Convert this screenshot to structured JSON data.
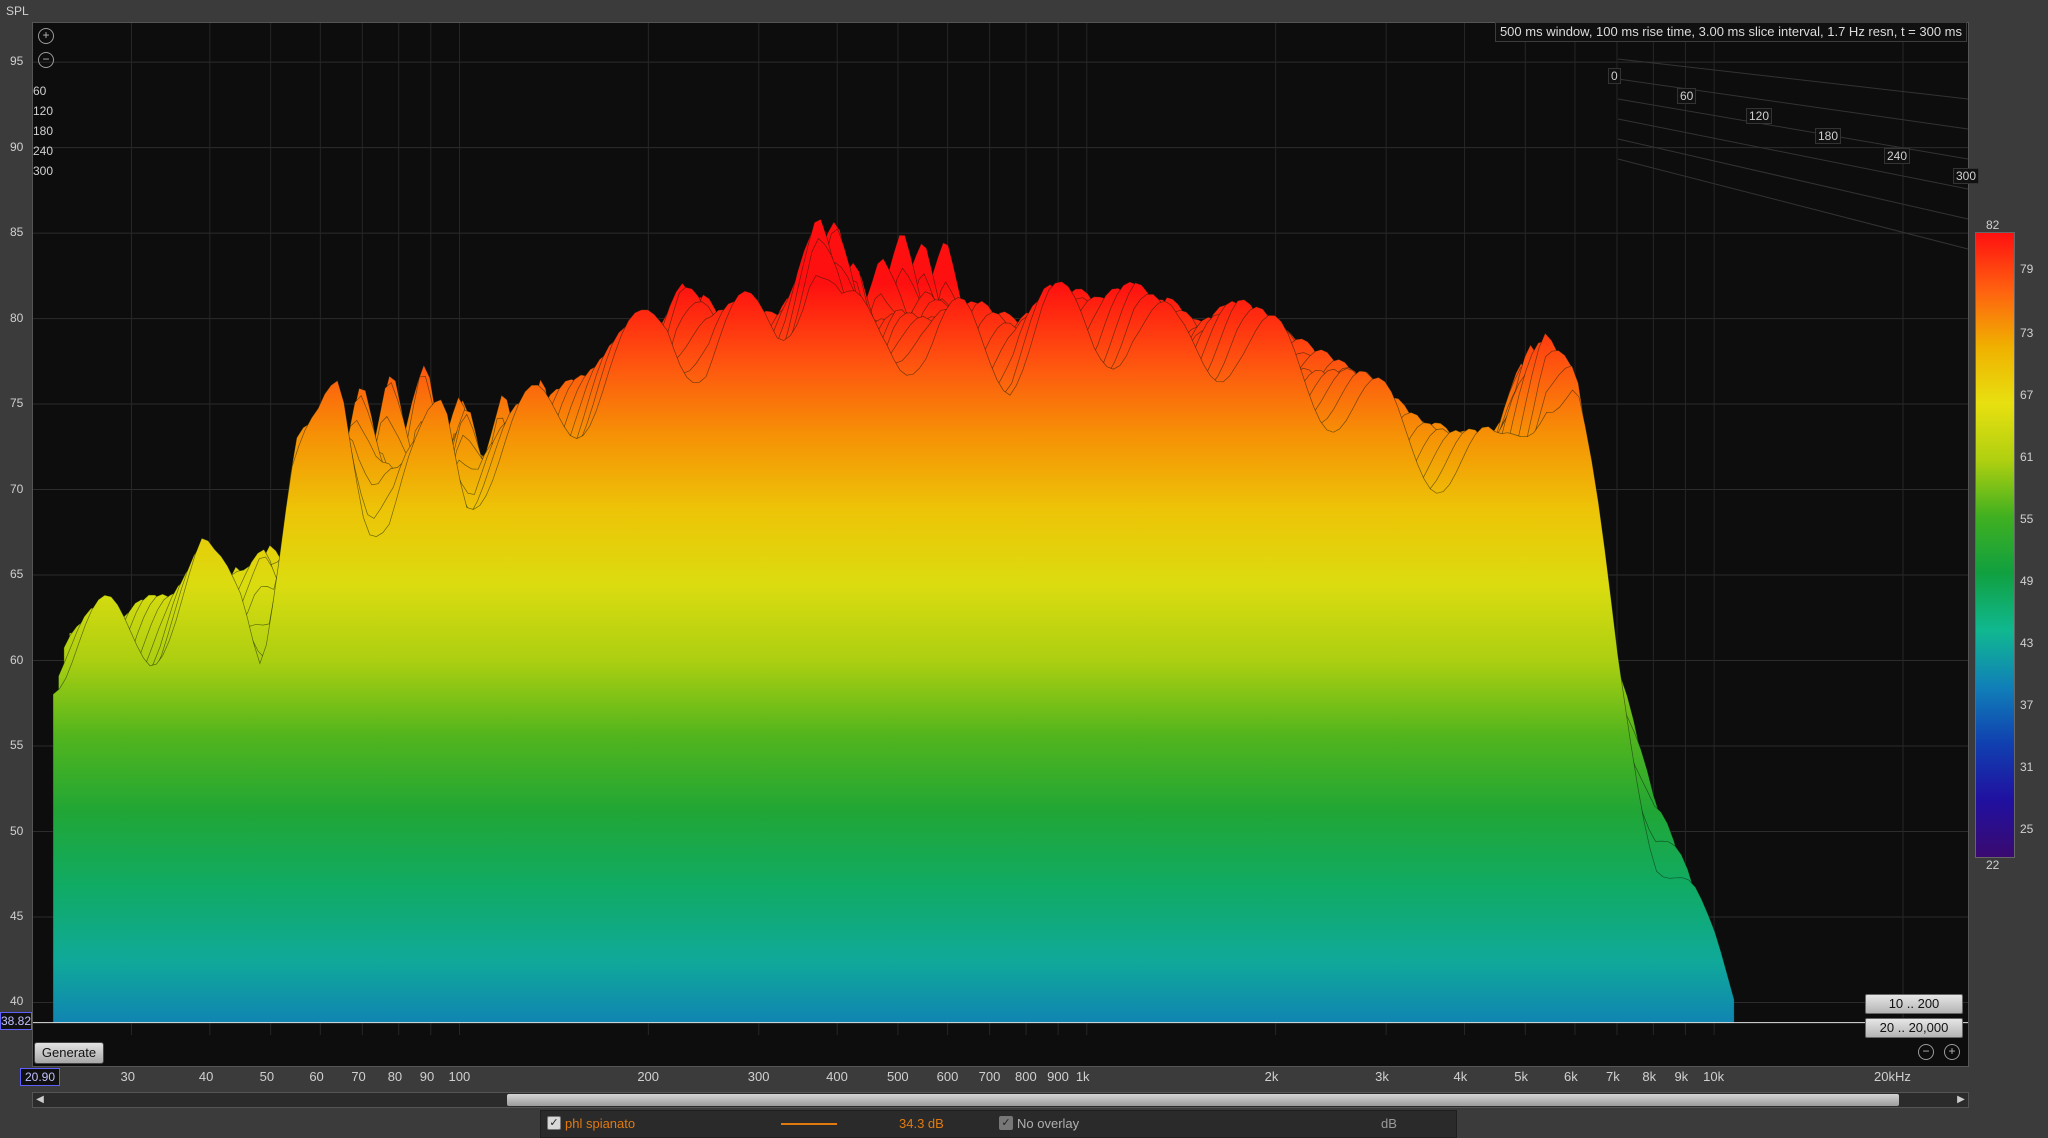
{
  "header": {
    "axis_title": "SPL",
    "info": "500 ms window, 100 ms rise time, 3.00 ms slice interval, 1.7 Hz resn, t = 300 ms"
  },
  "chart_data": {
    "type": "waterfall",
    "title": "",
    "y_label": "SPL",
    "y_ticks": [
      "95",
      "90",
      "85",
      "80",
      "75",
      "70",
      "65",
      "60",
      "55",
      "50",
      "45",
      "40"
    ],
    "ylim": [
      38.8,
      96
    ],
    "x_scale": "log",
    "xlim": [
      20.9,
      20000
    ],
    "x_ticks": [
      {
        "v": 30,
        "t": "30"
      },
      {
        "v": 40,
        "t": "40"
      },
      {
        "v": 50,
        "t": "50"
      },
      {
        "v": 60,
        "t": "60"
      },
      {
        "v": 70,
        "t": "70"
      },
      {
        "v": 80,
        "t": "80"
      },
      {
        "v": 90,
        "t": "90"
      },
      {
        "v": 100,
        "t": "100"
      },
      {
        "v": 200,
        "t": "200"
      },
      {
        "v": 300,
        "t": "300"
      },
      {
        "v": 400,
        "t": "400"
      },
      {
        "v": 500,
        "t": "500"
      },
      {
        "v": 600,
        "t": "600"
      },
      {
        "v": 700,
        "t": "700"
      },
      {
        "v": 800,
        "t": "800"
      },
      {
        "v": 900,
        "t": "900"
      },
      {
        "v": 1000,
        "t": "1k"
      },
      {
        "v": 2000,
        "t": "2k"
      },
      {
        "v": 3000,
        "t": "3k"
      },
      {
        "v": 4000,
        "t": "4k"
      },
      {
        "v": 5000,
        "t": "5k"
      },
      {
        "v": 6000,
        "t": "6k"
      },
      {
        "v": 7000,
        "t": "7k"
      },
      {
        "v": 8000,
        "t": "8k"
      },
      {
        "v": 9000,
        "t": "9k"
      },
      {
        "v": 10000,
        "t": "10k"
      },
      {
        "v": 20000,
        "t": "20kHz"
      }
    ],
    "time_ticks": [
      "0",
      "60",
      "120",
      "180",
      "240",
      "300"
    ],
    "time_unit": "ms",
    "colormap": {
      "min": 22,
      "max": 82,
      "labels": [
        "82",
        "79",
        "73",
        "67",
        "61",
        "55",
        "49",
        "43",
        "37",
        "31",
        "25",
        "22"
      ],
      "stops": [
        "#ff1010",
        "#ff6010",
        "#f0b000",
        "#e8e010",
        "#b0d010",
        "#40b020",
        "#10a040",
        "#10b890",
        "#1080b8",
        "#1040b0",
        "#2010a0",
        "#3a0a70"
      ]
    },
    "front_slice_peaks": [
      {
        "f": 22,
        "db": 60.5
      },
      {
        "f": 26,
        "db": 61.5
      },
      {
        "f": 30,
        "db": 62
      },
      {
        "f": 33,
        "db": 63.5
      },
      {
        "f": 36,
        "db": 65
      },
      {
        "f": 38,
        "db": 64
      },
      {
        "f": 42,
        "db": 64.5
      },
      {
        "f": 45,
        "db": 62
      },
      {
        "f": 50,
        "db": 71
      },
      {
        "f": 55,
        "db": 72
      },
      {
        "f": 60,
        "db": 76
      },
      {
        "f": 66,
        "db": 70
      },
      {
        "f": 72,
        "db": 69
      },
      {
        "f": 80,
        "db": 71
      },
      {
        "f": 88,
        "db": 74.5
      },
      {
        "f": 95,
        "db": 71
      },
      {
        "f": 105,
        "db": 72
      },
      {
        "f": 115,
        "db": 73
      },
      {
        "f": 125,
        "db": 74
      },
      {
        "f": 140,
        "db": 75
      },
      {
        "f": 160,
        "db": 77
      },
      {
        "f": 180,
        "db": 78
      },
      {
        "f": 200,
        "db": 80
      },
      {
        "f": 230,
        "db": 78
      },
      {
        "f": 260,
        "db": 79
      },
      {
        "f": 300,
        "db": 80
      },
      {
        "f": 340,
        "db": 84
      },
      {
        "f": 380,
        "db": 79
      },
      {
        "f": 450,
        "db": 80
      },
      {
        "f": 520,
        "db": 78
      },
      {
        "f": 600,
        "db": 79
      },
      {
        "f": 700,
        "db": 78
      },
      {
        "f": 800,
        "db": 80
      },
      {
        "f": 950,
        "db": 79
      },
      {
        "f": 1100,
        "db": 80
      },
      {
        "f": 1300,
        "db": 78
      },
      {
        "f": 1600,
        "db": 79
      },
      {
        "f": 2000,
        "db": 77
      },
      {
        "f": 2500,
        "db": 75
      },
      {
        "f": 3000,
        "db": 73
      },
      {
        "f": 3500,
        "db": 72
      },
      {
        "f": 4200,
        "db": 71
      },
      {
        "f": 5000,
        "db": 77
      },
      {
        "f": 5600,
        "db": 75
      },
      {
        "f": 6500,
        "db": 60
      },
      {
        "f": 7500,
        "db": 50
      },
      {
        "f": 9000,
        "db": 43
      },
      {
        "f": 10000,
        "db": 41
      }
    ]
  },
  "controls": {
    "generate": "Generate",
    "cursor_value": "38.82",
    "x_start": "20.90",
    "range_time": "10 .. 200",
    "range_freq": "20 .. 20,000",
    "scroll_left": "◀",
    "scroll_right": "▶"
  },
  "legend": {
    "trace_name": "phl spianato",
    "trace_value": "34.3 dB",
    "overlay": "No overlay",
    "unit": "dB",
    "trace_color": "#e07a10"
  }
}
